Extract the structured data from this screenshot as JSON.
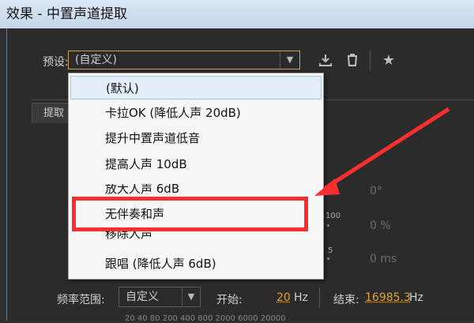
{
  "window": {
    "title": "效果 - 中置声道提取"
  },
  "preset": {
    "label": "预设:",
    "selected": "(自定义)",
    "items": [
      {
        "label": "(默认)"
      },
      {
        "label": "卡拉OK (降低人声 20dB)"
      },
      {
        "label": "提升中置声道低音"
      },
      {
        "label": "提高人声 10dB"
      },
      {
        "label": "放大人声 6dB"
      },
      {
        "label": "无伴奏和声"
      },
      {
        "label": "移除人声"
      },
      {
        "label": "跟唱 (降低人声 6dB)"
      }
    ]
  },
  "toolbar": {
    "save_icon": "download-icon",
    "delete_icon": "trash-icon",
    "favorite_icon": "star-icon"
  },
  "panel": {
    "tab_label": "提取",
    "readouts": [
      "0°",
      "0 %",
      "0 ms"
    ],
    "knob_labels": [
      "100",
      "5"
    ]
  },
  "frequency": {
    "label": "频率范围:",
    "selected": "自定义",
    "start_label": "开始:",
    "start_value": "20",
    "start_unit": "Hz",
    "end_label": "结束:",
    "end_value": "16985.3",
    "end_unit": "Hz",
    "scale": "20 40 80 200 400 800 2000 6000 20000"
  },
  "colors": {
    "annotation": "#ff2e2e",
    "accent": "#e0a530",
    "selection": "#e4eef8"
  }
}
